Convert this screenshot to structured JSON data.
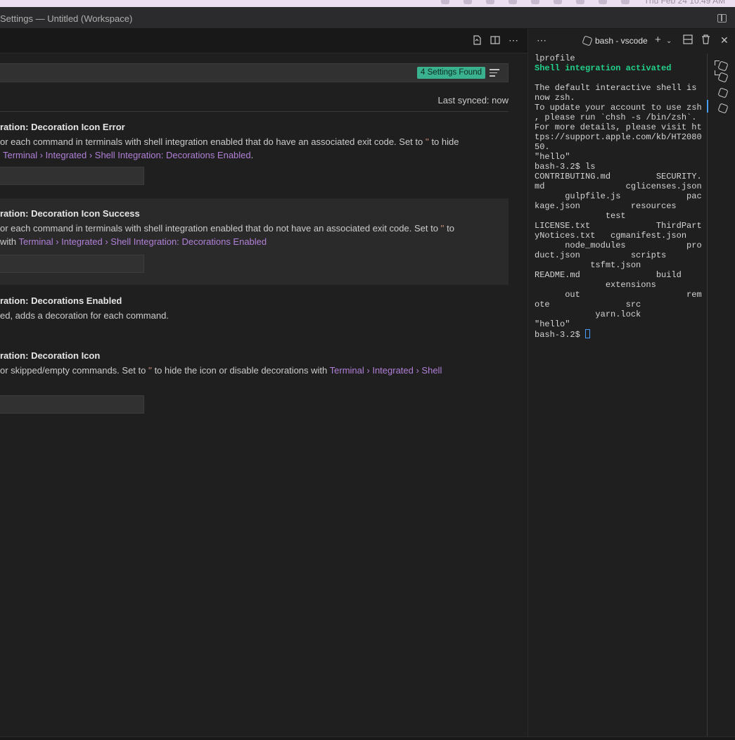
{
  "menubar": {
    "clock": "Thu Feb 24  10:49 AM"
  },
  "window": {
    "title": "Settings — Untitled (Workspace)"
  },
  "search": {
    "results_badge": "4 Settings Found"
  },
  "sync": {
    "status": "Last synced: now"
  },
  "settings": [
    {
      "title_prefix": "ration: ",
      "title": "Decoration Icon Error",
      "desc_line1_a": "or each command in terminals with shell integration enabled that do have an associated exit code. Set to ",
      "desc_line1_q": "''",
      "desc_line1_b": " to hide",
      "desc_line2_link": "Terminal › Integrated › Shell Integration: Decorations Enabled",
      "desc_line2_b": "."
    },
    {
      "title_prefix": "ration: ",
      "title": "Decoration Icon Success",
      "desc_line1_a": "or each command in terminals with shell integration enabled that do not have an associated exit code. Set to ",
      "desc_line1_q": "''",
      "desc_line1_b": " to",
      "desc_line2_a": " with ",
      "desc_line2_link": "Terminal › Integrated › Shell Integration: Decorations Enabled"
    },
    {
      "title_prefix": "ration: ",
      "title": "Decorations Enabled",
      "desc_line1_a": "ed, adds a decoration for each command."
    },
    {
      "title_prefix": "ration: ",
      "title": "Decoration Icon",
      "desc_line1_a": "or skipped/empty commands. Set to ",
      "desc_line1_q": "''",
      "desc_line1_b": " to hide the icon or disable decorations with ",
      "desc_line1_link": "Terminal › Integrated › Shell"
    }
  ],
  "terminal": {
    "name": "bash - vscode",
    "lines": [
      "lprofile",
      "Shell integration activated",
      "",
      "The default interactive shell is",
      "now zsh.",
      "To update your account to use zsh",
      ", please run `chsh -s /bin/zsh`.",
      "For more details, please visit ht",
      "tps://support.apple.com/kb/HT2080",
      "50.",
      "\"hello\"",
      "bash-3.2$ ls",
      "CONTRIBUTING.md         SECURITY.",
      "md                cglicenses.json",
      "      gulpfile.js             pac",
      "kage.json          resources",
      "              test",
      "LICENSE.txt             ThirdPart",
      "yNotices.txt   cgmanifest.json",
      "      node_modules            pro",
      "duct.json          scripts",
      "           tsfmt.json",
      "README.md               build",
      "              extensions",
      "      out                     rem",
      "ote               src",
      "            yarn.lock",
      "\"hello\"",
      "bash-3.2$ "
    ]
  }
}
